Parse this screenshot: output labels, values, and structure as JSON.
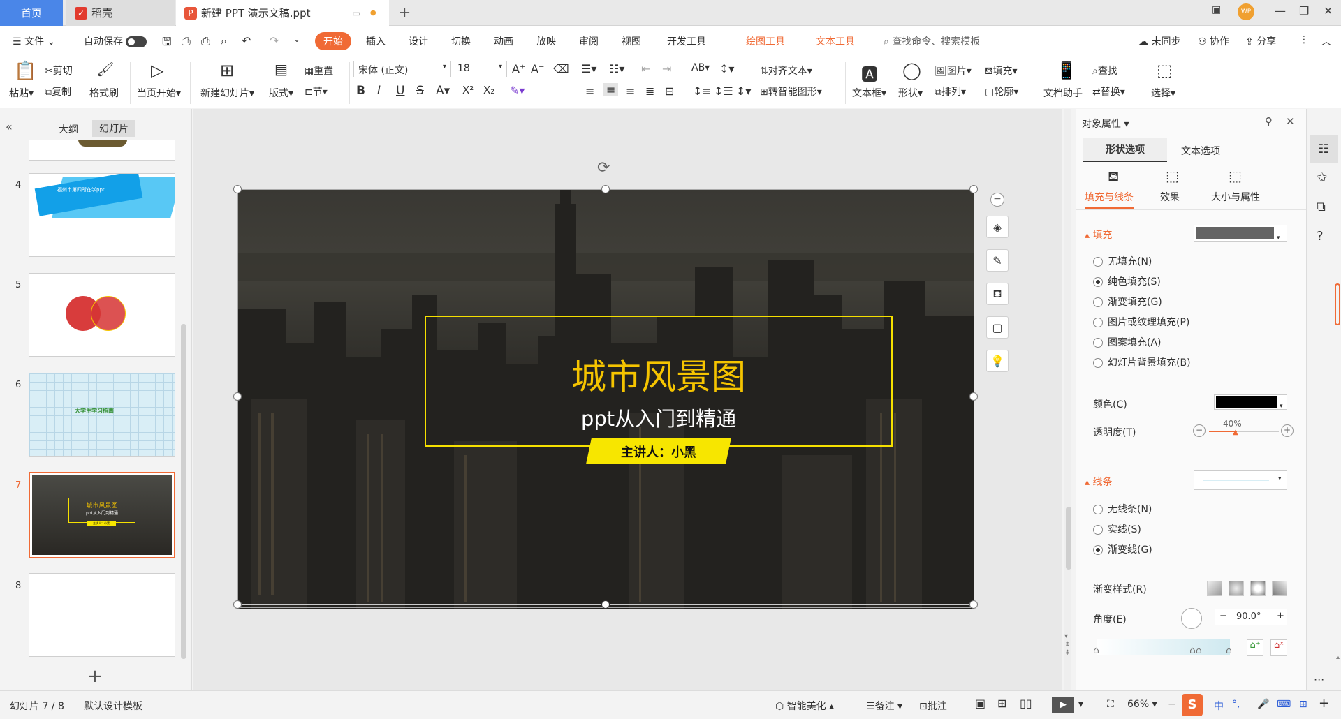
{
  "tabs": {
    "home": "首页",
    "daoke": "稻壳",
    "doc": "新建 PPT 演示文稿.ppt"
  },
  "window": {
    "avatar": "WP"
  },
  "menu": {
    "file": "文件",
    "autosave": "自动保存",
    "start": "开始",
    "insert": "插入",
    "design": "设计",
    "transition": "切换",
    "animation": "动画",
    "slideshow": "放映",
    "review": "审阅",
    "view": "视图",
    "developer": "开发工具",
    "drawing_tools": "绘图工具",
    "text_tools": "文本工具",
    "search": "查找命令、搜索模板",
    "unsynced": "未同步",
    "collab": "协作",
    "share": "分享"
  },
  "ribbon": {
    "paste": "粘贴",
    "cut": "剪切",
    "copy": "复制",
    "format_painter": "格式刷",
    "play_from_current": "当页开始",
    "new_slide": "新建幻灯片",
    "layout": "版式",
    "reset": "重置",
    "section": "节",
    "font_name": "宋体 (正文)",
    "font_size": "18",
    "align_text": "对齐文本",
    "smartart": "转智能图形",
    "textbox": "文本框",
    "shape": "形状",
    "arrange": "排列",
    "picture": "图片",
    "fill": "填充",
    "outline": "轮廓",
    "doc_helper": "文档助手",
    "find": "查找",
    "replace": "替换",
    "select": "选择"
  },
  "left_panel": {
    "outline_tab": "大纲",
    "slides_tab": "幻灯片",
    "slide_numbers": [
      "4",
      "5",
      "6",
      "7",
      "8"
    ],
    "thumb4_text": "福州市第四所在学ppt",
    "thumb6_text": "大学生学习指南",
    "thumb7_title": "城市风景图",
    "thumb7_sub": "ppt从入门到精通",
    "thumb7_tag": "主讲人：小黑"
  },
  "slide": {
    "title": "城市风景图",
    "subtitle": "ppt从入门到精通",
    "presenter": "主讲人：小黑"
  },
  "right_panel": {
    "title": "对象属性",
    "tab_shape": "形状选项",
    "tab_text": "文本选项",
    "sub_fill_line": "填充与线条",
    "sub_effect": "效果",
    "sub_size": "大小与属性",
    "fill_header": "填充",
    "fill_options": [
      "无填充(N)",
      "纯色填充(S)",
      "渐变填充(G)",
      "图片或纹理填充(P)",
      "图案填充(A)",
      "幻灯片背景填充(B)"
    ],
    "color_label": "颜色(C)",
    "transparency_label": "透明度(T)",
    "transparency_value": "40%",
    "line_header": "线条",
    "line_options": [
      "无线条(N)",
      "实线(S)",
      "渐变线(G)"
    ],
    "gradient_style_label": "渐变样式(R)",
    "angle_label": "角度(E)",
    "angle_value": "90.0°"
  },
  "status": {
    "slide_pos": "幻灯片 7 / 8",
    "template": "默认设计模板",
    "beautify": "智能美化",
    "notes": "备注",
    "comments": "批注",
    "zoom": "66%",
    "ime": "中"
  },
  "colors": {
    "accent": "#f06a35",
    "title_gold": "#f5c400",
    "tag_yellow": "#f7e600",
    "selection": "#f06a35"
  }
}
